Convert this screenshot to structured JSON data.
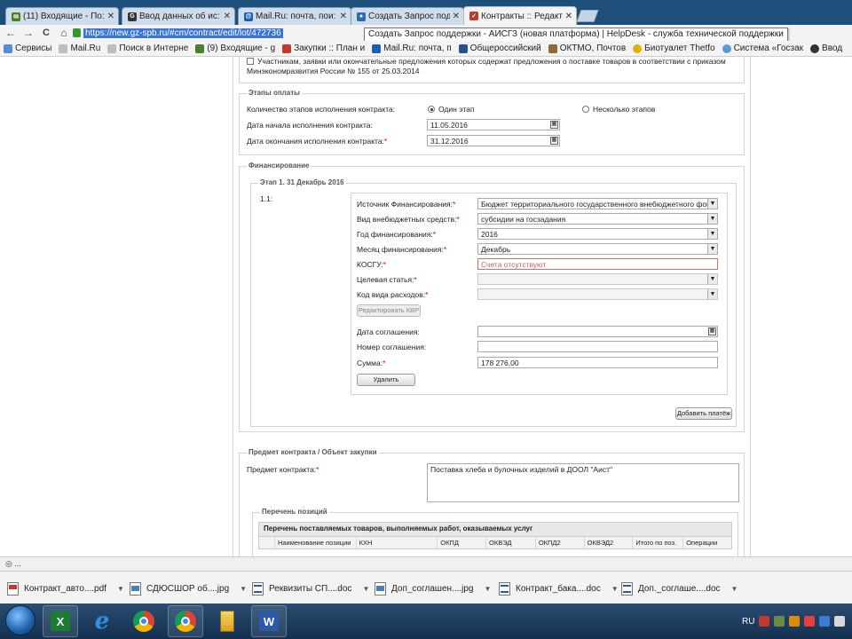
{
  "browser": {
    "tabs": [
      {
        "label": "(11) Входящие - По:",
        "icon_color": "#4b7f2b",
        "icon": "mail-icon",
        "active": false
      },
      {
        "label": "Ввод данных об ис:",
        "icon_color": "#333333",
        "icon": "g-icon",
        "active": false
      },
      {
        "label": "Mail.Ru: почта, пои:",
        "icon_color": "#1a5fb4",
        "icon": "mailru-icon",
        "active": false
      },
      {
        "label": "Создать Запрос под:",
        "icon_color": "#2a6cb0",
        "icon": "helpdesk-icon",
        "active": false
      },
      {
        "label": "Контракты :: Редакт:",
        "icon_color": "#c0392b",
        "icon": "contracts-icon",
        "active": true
      }
    ],
    "nav": {
      "back": "←",
      "forward": "→",
      "reload": "C",
      "home": "⌂"
    },
    "url": "https://new.gz-spb.ru/#cm/contract/edit/lot/472736",
    "tooltip": "Создать Запрос поддержки - АИСГЗ (новая платформа) | HelpDesk - служба технической поддержки",
    "bookmarks": [
      {
        "label": "Сервисы",
        "color": "#5a8ad6"
      },
      {
        "label": "Mail.Ru",
        "color": "#bdbdbd"
      },
      {
        "label": "Поиск в Интерне",
        "color": "#bdbdbd"
      },
      {
        "label": "(9) Входящие - g",
        "color": "#4b7f2b"
      },
      {
        "label": "Закупки :: План и",
        "color": "#c0392b"
      },
      {
        "label": "Mail.Ru: почта, п",
        "color": "#1a5fb4"
      },
      {
        "label": "Общероссийский",
        "color": "#2a4f8a"
      },
      {
        "label": "ОКТМО, Почтов",
        "color": "#8a6d3b"
      },
      {
        "label": "Биотуалет Thetfo",
        "color": "#e0b000"
      },
      {
        "label": "Система «Госзак",
        "color": "#5b9bd5"
      },
      {
        "label": "Ввод",
        "color": "#333333"
      }
    ]
  },
  "form": {
    "top_checkbox_text_line1": "Участникам, заявки или окончательные предложения которых содержат предложения о поставке товаров в соответствии с приказом",
    "top_checkbox_text_line2": "Минэкономразвития России № 155 от 25.03.2014",
    "payment": {
      "legend": "Этапы оплаты",
      "stages_label": "Количество этапов исполнения контракта:",
      "option_one": "Один этап",
      "option_many": "Несколько этапов",
      "start_label": "Дата начала исполнения контракта:",
      "start_value": "11.05.2016",
      "end_label": "Дата окончания исполнения контракта:",
      "end_value": "31.12.2016"
    },
    "financing": {
      "legend": "Финансирование",
      "stage_legend": "Этап 1. 31 Декабрь 2016",
      "row_number": "1.1:",
      "source_label": "Источник Финансирования:",
      "source_value": "Бюджет территориального государственного внебюджетного фонда",
      "extra_label": "Вид внебюджетных средств:",
      "extra_value": "субсидии на госзадания",
      "year_label": "Год финансирования:",
      "year_value": "2016",
      "month_label": "Месяц финансирования:",
      "month_value": "Декабрь",
      "kosgu_label": "КОСГУ:",
      "kosgu_value": "Счета отсутствуют",
      "target_label": "Целевая статья:",
      "kvr_label": "Код вида расходов:",
      "edit_kvr": "Редактировать КВР",
      "agreement_date_label": "Дата соглашения:",
      "agreement_num_label": "Номер соглашения:",
      "sum_label": "Сумма:",
      "sum_value": "178 276,00",
      "delete_button": "Удалить",
      "add_payment_button": "Добавить платёж"
    },
    "subject": {
      "legend": "Предмет контракта / Объект закупки",
      "label": "Предмет контракта:",
      "value": "Поставка хлеба и булочных изделий в ДООЛ \"Аист\""
    },
    "positions": {
      "legend": "Перечень позиций",
      "table_title": "Перечень поставляемых товаров, выполняемых работ, оказываемых услуг",
      "columns": [
        "Наименование позиции",
        "КХН",
        "ОКПД",
        "ОКВЭД",
        "ОКПД2",
        "ОКВЭД2",
        "Итого по поз.",
        "Операции"
      ]
    }
  },
  "status": "◎ ...",
  "downloads": [
    {
      "label": "Контракт_авто....pdf",
      "type": "pdf"
    },
    {
      "label": "СДЮСШОР об....jpg",
      "type": "jpg"
    },
    {
      "label": "Реквизиты СП....doc",
      "type": "doc"
    },
    {
      "label": "Доп_соглашен....jpg",
      "type": "jpg"
    },
    {
      "label": "Контракт_бака....doc",
      "type": "doc"
    },
    {
      "label": "Доп._соглаше....doc",
      "type": "doc"
    }
  ],
  "taskbar": {
    "apps": [
      "excel-icon",
      "ie-icon",
      "chrome-icon",
      "chrome-icon",
      "explorer-icon",
      "word-icon"
    ],
    "lang": "RU"
  }
}
